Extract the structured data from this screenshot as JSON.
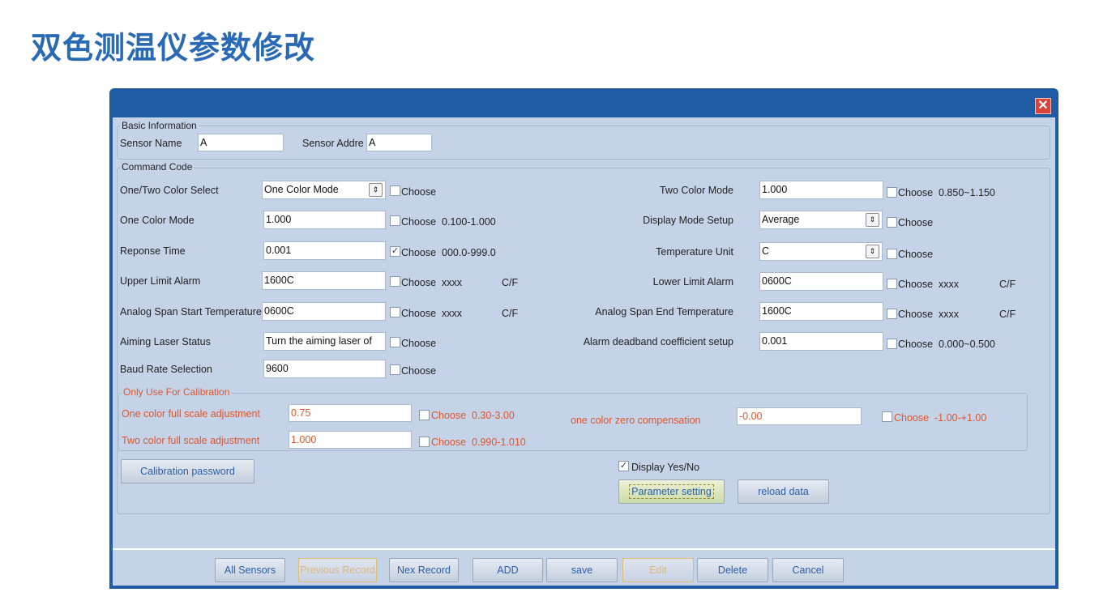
{
  "page_title": "双色测温仪参数修改",
  "window": {
    "close_icon": "close-icon",
    "close_glyph": "✕"
  },
  "basic": {
    "legend": "Basic Information",
    "sensor_name_label": "Sensor Name",
    "sensor_name_value": "A",
    "sensor_addr_label": "Sensor Addre",
    "sensor_addr_value": "A"
  },
  "command": {
    "legend": "Command Code",
    "choose": "Choose",
    "left": [
      {
        "label": "One/Two Color Select",
        "value": "One Color Mode",
        "select": true,
        "checked": false,
        "range": "",
        "unit": ""
      },
      {
        "label": "One Color Mode",
        "value": "1.000",
        "checked": false,
        "range": "0.100-1.000",
        "unit": ""
      },
      {
        "label": "Reponse Time",
        "value": "0.001",
        "checked": true,
        "range": "000.0-999.0",
        "unit": ""
      },
      {
        "label": "Upper Limit Alarm",
        "value": "1600C",
        "checked": false,
        "range": "xxxx",
        "unit": "C/F"
      },
      {
        "label": "Analog Span Start Temperature",
        "value": "0600C",
        "checked": false,
        "range": "xxxx",
        "unit": "C/F"
      },
      {
        "label": "Aiming Laser Status",
        "value": "Turn the aiming laser of",
        "checked": false,
        "range": "",
        "unit": ""
      },
      {
        "label": "Baud Rate Selection",
        "value": "9600",
        "checked": false,
        "range": "",
        "unit": ""
      }
    ],
    "right": [
      {
        "label": "Two Color Mode",
        "value": "1.000",
        "checked": false,
        "range": "0.850~1.150",
        "unit": ""
      },
      {
        "label": "Display Mode Setup",
        "value": "Average",
        "select": true,
        "checked": false,
        "range": "",
        "unit": ""
      },
      {
        "label": "Temperature Unit",
        "value": "C",
        "select": true,
        "checked": false,
        "range": "",
        "unit": ""
      },
      {
        "label": "Lower Limit Alarm",
        "value": "0600C",
        "checked": false,
        "range": "xxxx",
        "unit": "C/F"
      },
      {
        "label": "Analog Span End Temperature",
        "value": "1600C",
        "checked": false,
        "range": "xxxx",
        "unit": "C/F"
      },
      {
        "label": "Alarm deadband coefficient setup",
        "value": "0.001",
        "checked": false,
        "range": "0.000~0.500",
        "unit": ""
      }
    ]
  },
  "calibration": {
    "legend": "Only Use For Calibration",
    "rows": [
      {
        "label": "One color full scale adjustment",
        "value": "0.75",
        "checked": false,
        "range": "0.30-3.00"
      },
      {
        "label": "Two color full scale adjustment",
        "value": "1.000",
        "checked": false,
        "range": "0.990-1.010"
      },
      {
        "label": "one color zero compensation",
        "value": "-0.00",
        "checked": false,
        "range": "-1.00-+1.00"
      }
    ],
    "accent": "#e0562c"
  },
  "actions": {
    "calibration_password": "Calibration password",
    "display_label": "Display Yes/No",
    "display_checked": true,
    "parameter_setting": "Parameter setting",
    "reload_data": "reload data"
  },
  "footer": {
    "buttons": [
      {
        "label": "All Sensors",
        "disabled": false
      },
      {
        "label": "Previous Record",
        "disabled": true
      },
      {
        "label": "Nex Record",
        "disabled": false
      },
      {
        "label": "ADD",
        "disabled": false
      },
      {
        "label": "save",
        "disabled": false
      },
      {
        "label": "Edit",
        "disabled": true
      },
      {
        "label": "Delete",
        "disabled": false
      },
      {
        "label": "Cancel",
        "disabled": false
      }
    ]
  }
}
